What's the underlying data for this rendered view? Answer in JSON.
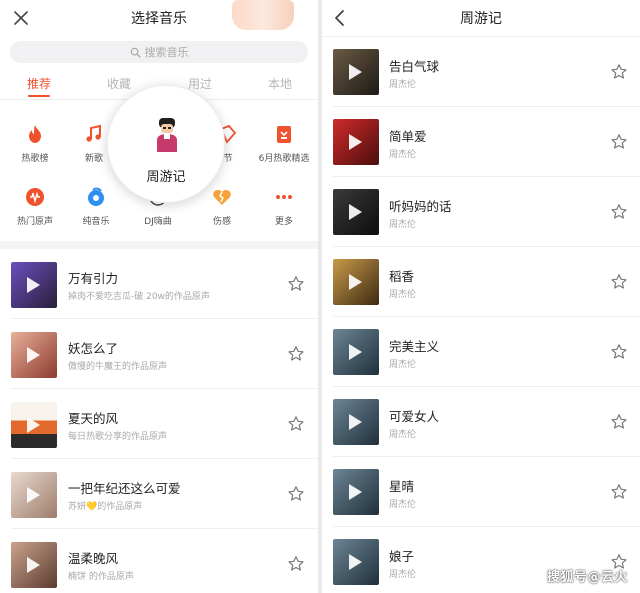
{
  "left": {
    "title": "选择音乐",
    "search_placeholder": "搜索音乐",
    "tabs": [
      {
        "label": "推荐"
      },
      {
        "label": "收藏"
      },
      {
        "label": "用过"
      },
      {
        "label": "本地"
      }
    ],
    "categories_row1": [
      {
        "label": "热歌榜",
        "icon": "flame-icon",
        "color": "#f0522d"
      },
      {
        "label": "新歌",
        "icon": "music-note-icon",
        "color": "#f0522d"
      },
      {
        "label": "",
        "icon": "",
        "color": ""
      },
      {
        "label": "节",
        "icon": "festival-icon",
        "color": "#f0522d"
      },
      {
        "label": "6月热歌精选",
        "icon": "calendar-icon",
        "color": "#f0522d"
      }
    ],
    "categories_row2": [
      {
        "label": "热门原声",
        "icon": "waveform-icon",
        "color": "#f0522d"
      },
      {
        "label": "纯音乐",
        "icon": "drop-icon",
        "color": "#2f8ff0"
      },
      {
        "label": "DJ嗨曲",
        "icon": "dj-icon",
        "color": "#222222"
      },
      {
        "label": "伤感",
        "icon": "broken-heart-icon",
        "color": "#f6a23b"
      },
      {
        "label": "更多",
        "icon": "more-dots-icon",
        "color": "#f0522d"
      }
    ],
    "popup": {
      "title": "周游记",
      "icon": "avatar-icon"
    },
    "songs": [
      {
        "title": "万有引力",
        "subtitle": "掉肉不爱吃吉瓜-破 20w的作品原声"
      },
      {
        "title": "妖怎么了",
        "subtitle": "傲慢的牛魔王的作品原声"
      },
      {
        "title": "夏天的风",
        "subtitle": "每日热歌分享的作品原声"
      },
      {
        "title": "一把年纪还这么可爱",
        "subtitle": "苏妍💛的作品原声"
      },
      {
        "title": "温柔晚风",
        "subtitle": "楠饼 的作品原声"
      }
    ]
  },
  "right": {
    "title": "周游记",
    "songs": [
      {
        "title": "告白气球",
        "artist": "周杰伦"
      },
      {
        "title": "简单爱",
        "artist": "周杰伦"
      },
      {
        "title": "听妈妈的话",
        "artist": "周杰伦"
      },
      {
        "title": "稻香",
        "artist": "周杰伦"
      },
      {
        "title": "完美主义",
        "artist": "周杰伦"
      },
      {
        "title": "可爱女人",
        "artist": "周杰伦"
      },
      {
        "title": "星晴",
        "artist": "周杰伦"
      },
      {
        "title": "娘子",
        "artist": "周杰伦"
      }
    ]
  },
  "watermark": "搜狐号@云火",
  "colors": {
    "accent": "#f0522d",
    "text": "#222222",
    "muted": "#a8a8a8"
  }
}
